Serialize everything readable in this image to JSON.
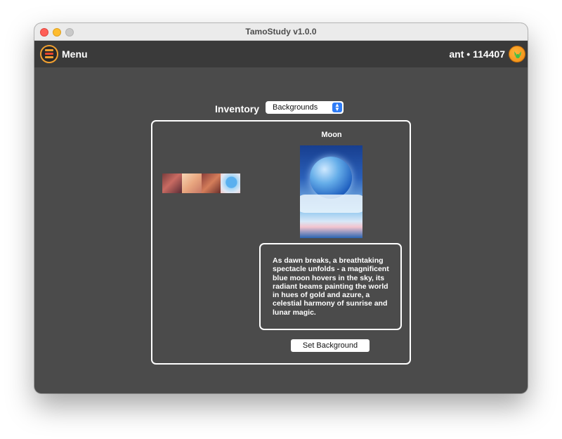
{
  "window": {
    "title": "TamoStudy v1.0.0"
  },
  "appbar": {
    "menu_label": "Menu",
    "user_info": "ant • 114407"
  },
  "inventory": {
    "label": "Inventory",
    "category_selected": "Backgrounds"
  },
  "thumbnails": [
    "background-thumb-1",
    "background-thumb-2",
    "background-thumb-3",
    "background-thumb-moon"
  ],
  "selected_item": {
    "title": "Moon",
    "description": "As dawn breaks, a breathtaking spectacle unfolds - a magnificent blue moon hovers in the sky, its radiant beams painting the world in hues of gold and azure, a celestial harmony of sunrise and lunar magic."
  },
  "actions": {
    "set_background": "Set Background"
  },
  "colors": {
    "window_bg": "#4b4b4b",
    "appbar_bg": "#3a3a3a",
    "accent_orange": "#f2a030",
    "select_accent": "#2f7cf6"
  }
}
